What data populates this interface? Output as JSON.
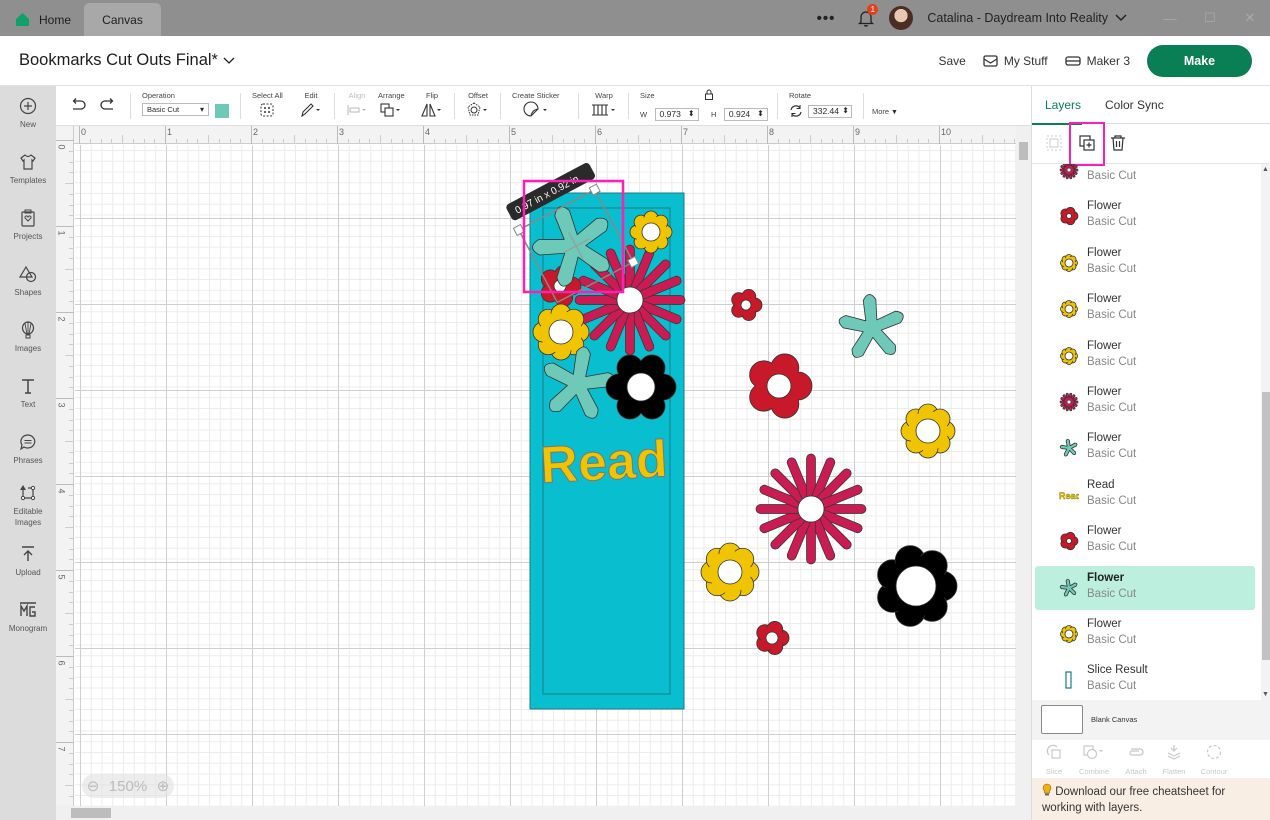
{
  "titlebar": {
    "tabs": [
      {
        "label": "Home",
        "icon": "home-icon"
      },
      {
        "label": "Canvas"
      }
    ],
    "more_icon": "more-dots-icon",
    "notification_count": "1",
    "user_name": "Catalina - Daydream Into Reality",
    "window_controls": [
      "minimize",
      "maximize",
      "close"
    ]
  },
  "header": {
    "project_title": "Bookmarks Cut Outs Final*",
    "save_label": "Save",
    "my_stuff_label": "My Stuff",
    "machine_label": "Maker 3",
    "make_label": "Make"
  },
  "leftnav": {
    "items": [
      {
        "label": "New",
        "icon": "plus-circle-icon"
      },
      {
        "label": "Templates",
        "icon": "shirt-icon"
      },
      {
        "label": "Projects",
        "icon": "projects-icon"
      },
      {
        "label": "Shapes",
        "icon": "shapes-icon"
      },
      {
        "label": "Images",
        "icon": "balloon-icon"
      },
      {
        "label": "Text",
        "icon": "text-icon"
      },
      {
        "label": "Phrases",
        "icon": "speech-bubble-icon"
      },
      {
        "label": "Editable Images",
        "icon": "editable-image-icon"
      },
      {
        "label": "Upload",
        "icon": "upload-icon"
      },
      {
        "label": "Monogram",
        "icon": "monogram-icon"
      }
    ]
  },
  "toolbar": {
    "operation_label": "Operation",
    "operation_value": "Basic Cut",
    "operation_color": "#6ec9b8",
    "select_all_label": "Select All",
    "edit_label": "Edit",
    "align_label": "Align",
    "arrange_label": "Arrange",
    "flip_label": "Flip",
    "offset_label": "Offset",
    "create_sticker_label": "Create Sticker",
    "warp_label": "Warp",
    "size_label": "Size",
    "w_label": "W",
    "w_value": "0.973",
    "h_label": "H",
    "h_value": "0.924",
    "rotate_label": "Rotate",
    "rotate_value": "332.44",
    "more_label": "More"
  },
  "canvas": {
    "h_ruler": [
      "0",
      "1",
      "2",
      "3",
      "4",
      "5",
      "6",
      "7",
      "8",
      "9",
      "10"
    ],
    "v_ruler": [
      "0",
      "1",
      "2",
      "3",
      "4",
      "5",
      "6",
      "7"
    ],
    "selection_dimension": "0.97 in x 0.92 in",
    "zoom_level": "150%",
    "read_text": "Read",
    "colors": {
      "teal": "#6ec9b8",
      "red": "#c8192b",
      "yellow": "#f0c400",
      "magenta": "#c81c52",
      "black": "#000000",
      "frame": "#09bfcf",
      "highlight": "#ff1fb4"
    }
  },
  "rpanel": {
    "tabs": [
      {
        "label": "Layers",
        "active": true
      },
      {
        "label": "Color Sync",
        "active": false
      }
    ],
    "layers": [
      {
        "name": "",
        "operation": "Basic Cut",
        "icon": "magenta-daisy-icon"
      },
      {
        "name": "Flower",
        "operation": "Basic Cut",
        "icon": "red-flower-icon"
      },
      {
        "name": "Flower",
        "operation": "Basic Cut",
        "icon": "yellow-flower-icon"
      },
      {
        "name": "Flower",
        "operation": "Basic Cut",
        "icon": "yellow-flower-icon"
      },
      {
        "name": "Flower",
        "operation": "Basic Cut",
        "icon": "yellow-flower-icon"
      },
      {
        "name": "Flower",
        "operation": "Basic Cut",
        "icon": "magenta-daisy-icon"
      },
      {
        "name": "Flower",
        "operation": "Basic Cut",
        "icon": "teal-star-flower-icon"
      },
      {
        "name": "Read",
        "operation": "Basic Cut",
        "icon": "read-text-icon"
      },
      {
        "name": "Flower",
        "operation": "Basic Cut",
        "icon": "red-flower-icon"
      },
      {
        "name": "Flower",
        "operation": "Basic Cut",
        "icon": "teal-star-flower-icon",
        "selected": true
      },
      {
        "name": "Flower",
        "operation": "Basic Cut",
        "icon": "yellow-flower-icon"
      },
      {
        "name": "Slice Result",
        "operation": "Basic Cut",
        "icon": "slice-rect-icon"
      }
    ],
    "blank_canvas_label": "Blank Canvas",
    "tools": [
      {
        "label": "Slice"
      },
      {
        "label": "Combine"
      },
      {
        "label": "Attach"
      },
      {
        "label": "Flatten"
      },
      {
        "label": "Contour"
      }
    ],
    "tip": "Download our free cheatsheet for working with layers."
  }
}
